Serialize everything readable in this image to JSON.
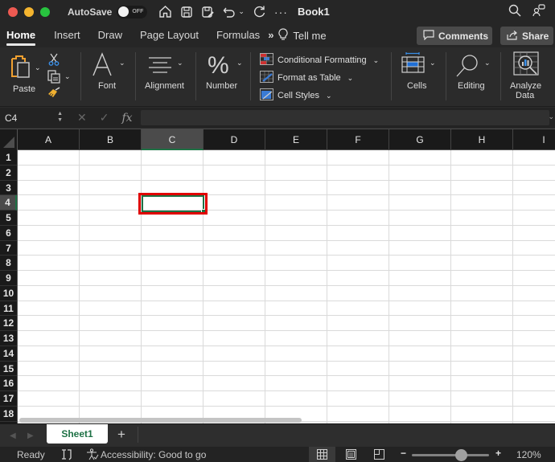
{
  "window": {
    "title": "Book1",
    "autosave_label": "AutoSave",
    "autosave_state": "OFF",
    "quick_access": [
      "home-icon",
      "save-icon",
      "save-as-icon",
      "undo-icon",
      "undo-dropdown-icon",
      "redo-icon",
      "more-icon"
    ]
  },
  "tabs": {
    "items": [
      {
        "label": "Home",
        "active": true
      },
      {
        "label": "Insert",
        "active": false
      },
      {
        "label": "Draw",
        "active": false
      },
      {
        "label": "Page Layout",
        "active": false
      },
      {
        "label": "Formulas",
        "active": false
      }
    ],
    "overflow": "»",
    "tell_me": "Tell me",
    "comments_label": "Comments",
    "share_label": "Share"
  },
  "ribbon": {
    "paste_label": "Paste",
    "font_label": "Font",
    "alignment_label": "Alignment",
    "number_label": "Number",
    "conditional_formatting_label": "Conditional Formatting",
    "format_as_table_label": "Format as Table",
    "cell_styles_label": "Cell Styles",
    "cells_label": "Cells",
    "editing_label": "Editing",
    "analyze_label_1": "Analyze",
    "analyze_label_2": "Data"
  },
  "formula_bar": {
    "name_box": "C4",
    "formula_value": "",
    "fx_label": "fx"
  },
  "grid": {
    "columns": [
      "A",
      "B",
      "C",
      "D",
      "E",
      "F",
      "G",
      "H",
      "I"
    ],
    "rows": [
      "1",
      "2",
      "3",
      "4",
      "5",
      "6",
      "7",
      "8",
      "9",
      "10",
      "11",
      "12",
      "13",
      "14",
      "15",
      "16",
      "17",
      "18"
    ],
    "selected_cell": "C4",
    "selected_column": "C",
    "selected_row": "4"
  },
  "sheets": {
    "items": [
      {
        "label": "Sheet1",
        "active": true
      }
    ],
    "add_label": "+"
  },
  "status": {
    "ready": "Ready",
    "accessibility": "Accessibility: Good to go",
    "zoom_level": "120%",
    "zoom_percent": 120,
    "zoom_minus": "−",
    "zoom_plus": "+"
  },
  "colors": {
    "accent_green": "#1e7145",
    "highlight_red": "#e00000",
    "sheet_tab_text": "#1e7145"
  }
}
